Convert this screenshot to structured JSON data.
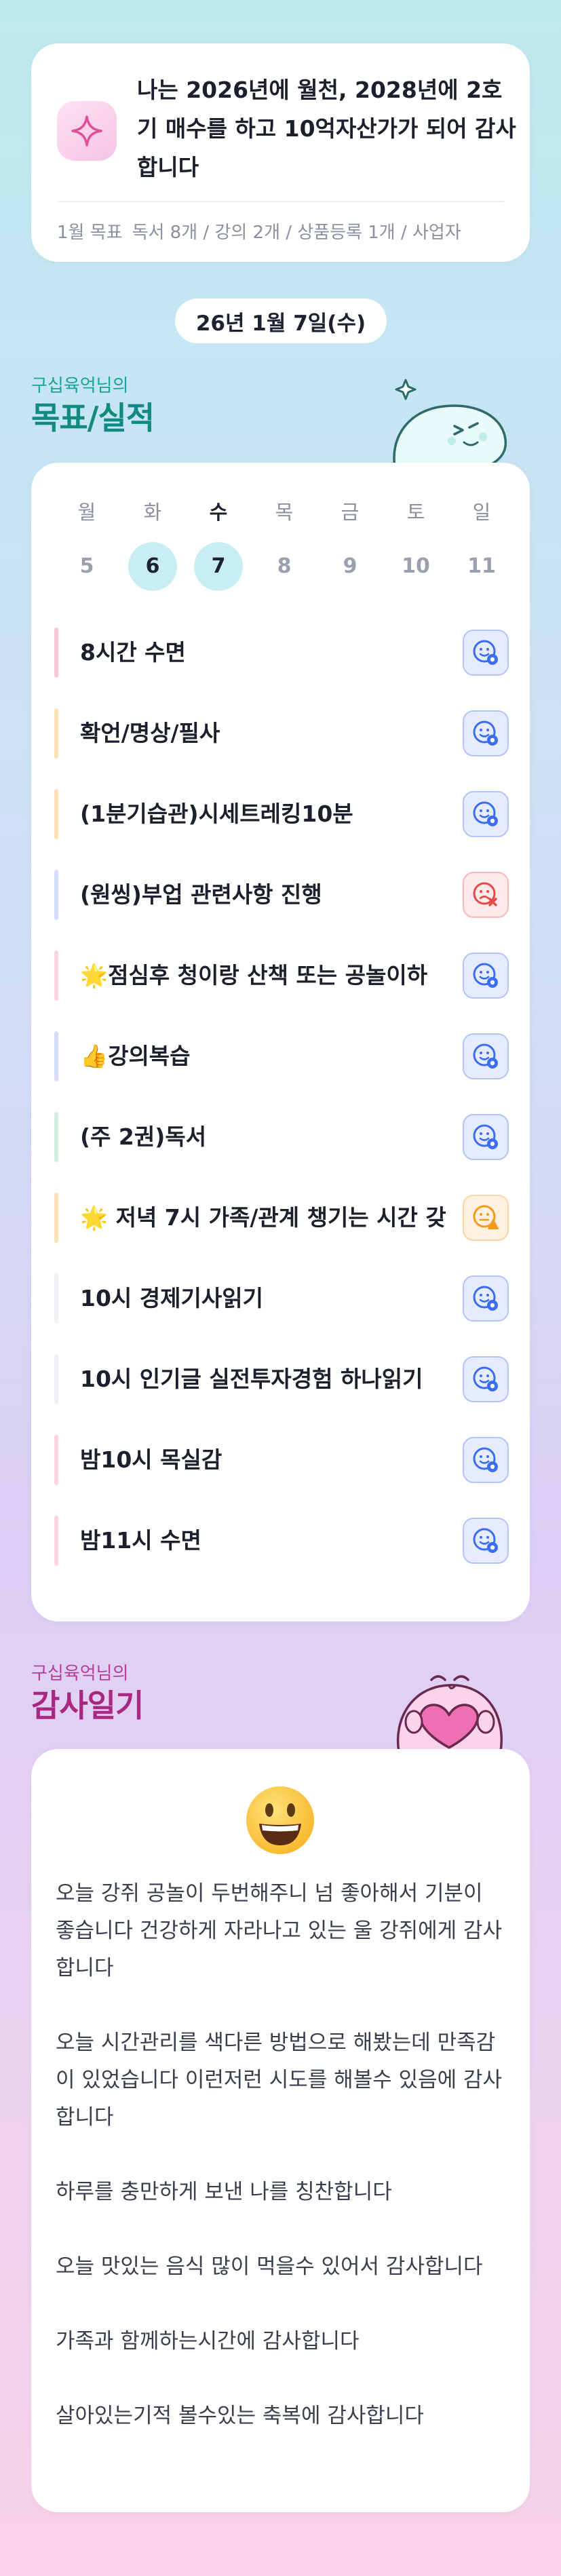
{
  "goal": {
    "text": "나는 2026년에 월천, 2028년에 2호기 매수를 하고 10억자산가가 되어 감사합니다",
    "sub_label": "1월 목표",
    "sub_value": "독서 8개 / 강의 2개 / 상품등록 1개 / 사업자",
    "icon": "sparkle-icon"
  },
  "date_label": "26년 1월 7일(수)",
  "schedule_section": {
    "subtitle": "구십육억님의",
    "title": "목표/실적",
    "subtitle_color": "#1aa39a",
    "title_color": "#128a82"
  },
  "week": {
    "days": [
      {
        "label": "월",
        "date": "5"
      },
      {
        "label": "화",
        "date": "6"
      },
      {
        "label": "수",
        "date": "7"
      },
      {
        "label": "목",
        "date": "8"
      },
      {
        "label": "금",
        "date": "9"
      },
      {
        "label": "토",
        "date": "10"
      },
      {
        "label": "일",
        "date": "11"
      }
    ]
  },
  "tasks": [
    {
      "title": "8시간 수면",
      "bar_color": "#f7c6d9",
      "status": "done"
    },
    {
      "title": "확언/명상/필사",
      "bar_color": "#fbe2b8",
      "status": "done"
    },
    {
      "title": "(1분기습관)시세트레킹10분",
      "bar_color": "#fbe2b8",
      "status": "done"
    },
    {
      "title": "(원씽)부업 관련사항 진행",
      "bar_color": "#d8dcfb",
      "status": "fail"
    },
    {
      "title": "🌟점심후 청이랑 산책 또는 공놀이하",
      "bar_color": "#fbd4e2",
      "status": "done"
    },
    {
      "title": "👍강의복습",
      "bar_color": "#d8dcfb",
      "status": "done"
    },
    {
      "title": "(주 2권)독서",
      "bar_color": "#cfeee0",
      "status": "done"
    },
    {
      "title": "🌟 저녁 7시 가족/관계 챙기는 시간 갖",
      "bar_color": "#fbe2b8",
      "status": "partial"
    },
    {
      "title": "10시 경제기사읽기",
      "bar_color": "#eef0f4",
      "status": "done"
    },
    {
      "title": "10시 인기글 실전투자경험 하나읽기",
      "bar_color": "#eef0f4",
      "status": "done"
    },
    {
      "title": "밤10시 목실감",
      "bar_color": "#fbd4e2",
      "status": "done"
    },
    {
      "title": "밤11시 수면",
      "bar_color": "#fbd4e2",
      "status": "done"
    }
  ],
  "gratitude_section": {
    "subtitle": "구십육억님의",
    "title": "감사일기",
    "subtitle_color": "#b0409a",
    "title_color": "#a8287f"
  },
  "gratitude": {
    "emoji": "grinning-face-icon",
    "entries": [
      "오늘 강쥐 공놀이 두번해주니 넘 좋아해서 기분이 좋습니다 건강하게 자라나고 있는 울 강쥐에게 감사합니다",
      "오늘 시간관리를 색다른 방법으로 해봤는데 만족감이 있었습니다 이런저런 시도를 해볼수 있음에 감사합니다",
      "하루를 충만하게 보낸 나를 칭찬합니다",
      "오늘 맛있는 음식 많이 먹을수 있어서 감사합니다",
      "가족과 함께하는시간에 감사합니다",
      "살아있는기적 볼수있는 축복에 감사합니다"
    ]
  }
}
